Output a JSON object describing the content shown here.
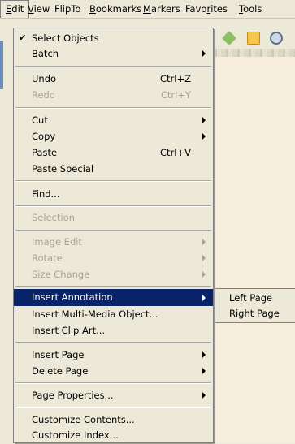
{
  "menubar": {
    "items": [
      {
        "pre": "",
        "ul": "E",
        "post": "dit"
      },
      {
        "pre": "",
        "ul": "V",
        "post": "iew"
      },
      {
        "pre": "FlipTo",
        "ul": "",
        "post": ""
      },
      {
        "pre": "",
        "ul": "B",
        "post": "ookmarks"
      },
      {
        "pre": "",
        "ul": "M",
        "post": "arkers"
      },
      {
        "pre": "Favo",
        "ul": "r",
        "post": "ites"
      },
      {
        "pre": "",
        "ul": "T",
        "post": "ools"
      }
    ]
  },
  "edit_menu": {
    "checkmark": "✔",
    "items": [
      {
        "label": "Select Objects",
        "checked": true
      },
      {
        "label": "Batch",
        "submenu": true
      },
      {
        "label": "Undo",
        "shortcut": "Ctrl+Z"
      },
      {
        "label": "Redo",
        "shortcut": "Ctrl+Y",
        "disabled": true
      },
      {
        "label": "Cut",
        "submenu": true
      },
      {
        "label": "Copy",
        "submenu": true
      },
      {
        "label": "Paste",
        "shortcut": "Ctrl+V"
      },
      {
        "label": "Paste Special"
      },
      {
        "label": "Find..."
      },
      {
        "label": "Selection",
        "disabled": true
      },
      {
        "label": "Image Edit",
        "submenu": true,
        "disabled": true
      },
      {
        "label": "Rotate",
        "submenu": true,
        "disabled": true
      },
      {
        "label": "Size Change",
        "submenu": true,
        "disabled": true
      },
      {
        "label": "Insert Annotation",
        "submenu": true,
        "highlighted": true
      },
      {
        "label": "Insert Multi-Media Object..."
      },
      {
        "label": "Insert Clip Art..."
      },
      {
        "label": "Insert Page",
        "submenu": true
      },
      {
        "label": "Delete Page",
        "submenu": true
      },
      {
        "label": "Page Properties...",
        "submenu": true
      },
      {
        "label": "Customize Contents..."
      },
      {
        "label": "Customize Index..."
      }
    ]
  },
  "submenu": {
    "items": [
      "Left Page",
      "Right Page"
    ]
  },
  "colors": {
    "highlight": "#0a246a",
    "menu_bg": "#ece9d8",
    "disabled_text": "#a8a595"
  },
  "toolbar_icons": [
    "tag-icon",
    "grid-icon",
    "disc-icon"
  ]
}
